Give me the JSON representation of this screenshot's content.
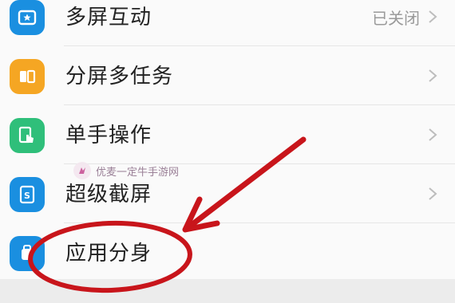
{
  "settings_list": {
    "items": [
      {
        "label": "多屏互动",
        "status": "已关闭",
        "icon": "multi-screen-icon",
        "color": "#1a8fe0"
      },
      {
        "label": "分屏多任务",
        "status": "",
        "icon": "split-screen-icon",
        "color": "#f5a623"
      },
      {
        "label": "单手操作",
        "status": "",
        "icon": "one-hand-icon",
        "color": "#2fbf7a"
      },
      {
        "label": "超级截屏",
        "status": "",
        "icon": "super-screenshot-icon",
        "color": "#1a8fe0"
      },
      {
        "label": "应用分身",
        "status": "",
        "icon": "app-clone-icon",
        "color": "#1a8fe0"
      }
    ]
  },
  "watermark": {
    "text": "优麦一定牛手游网"
  },
  "annotation": {
    "color": "#c8151b"
  }
}
